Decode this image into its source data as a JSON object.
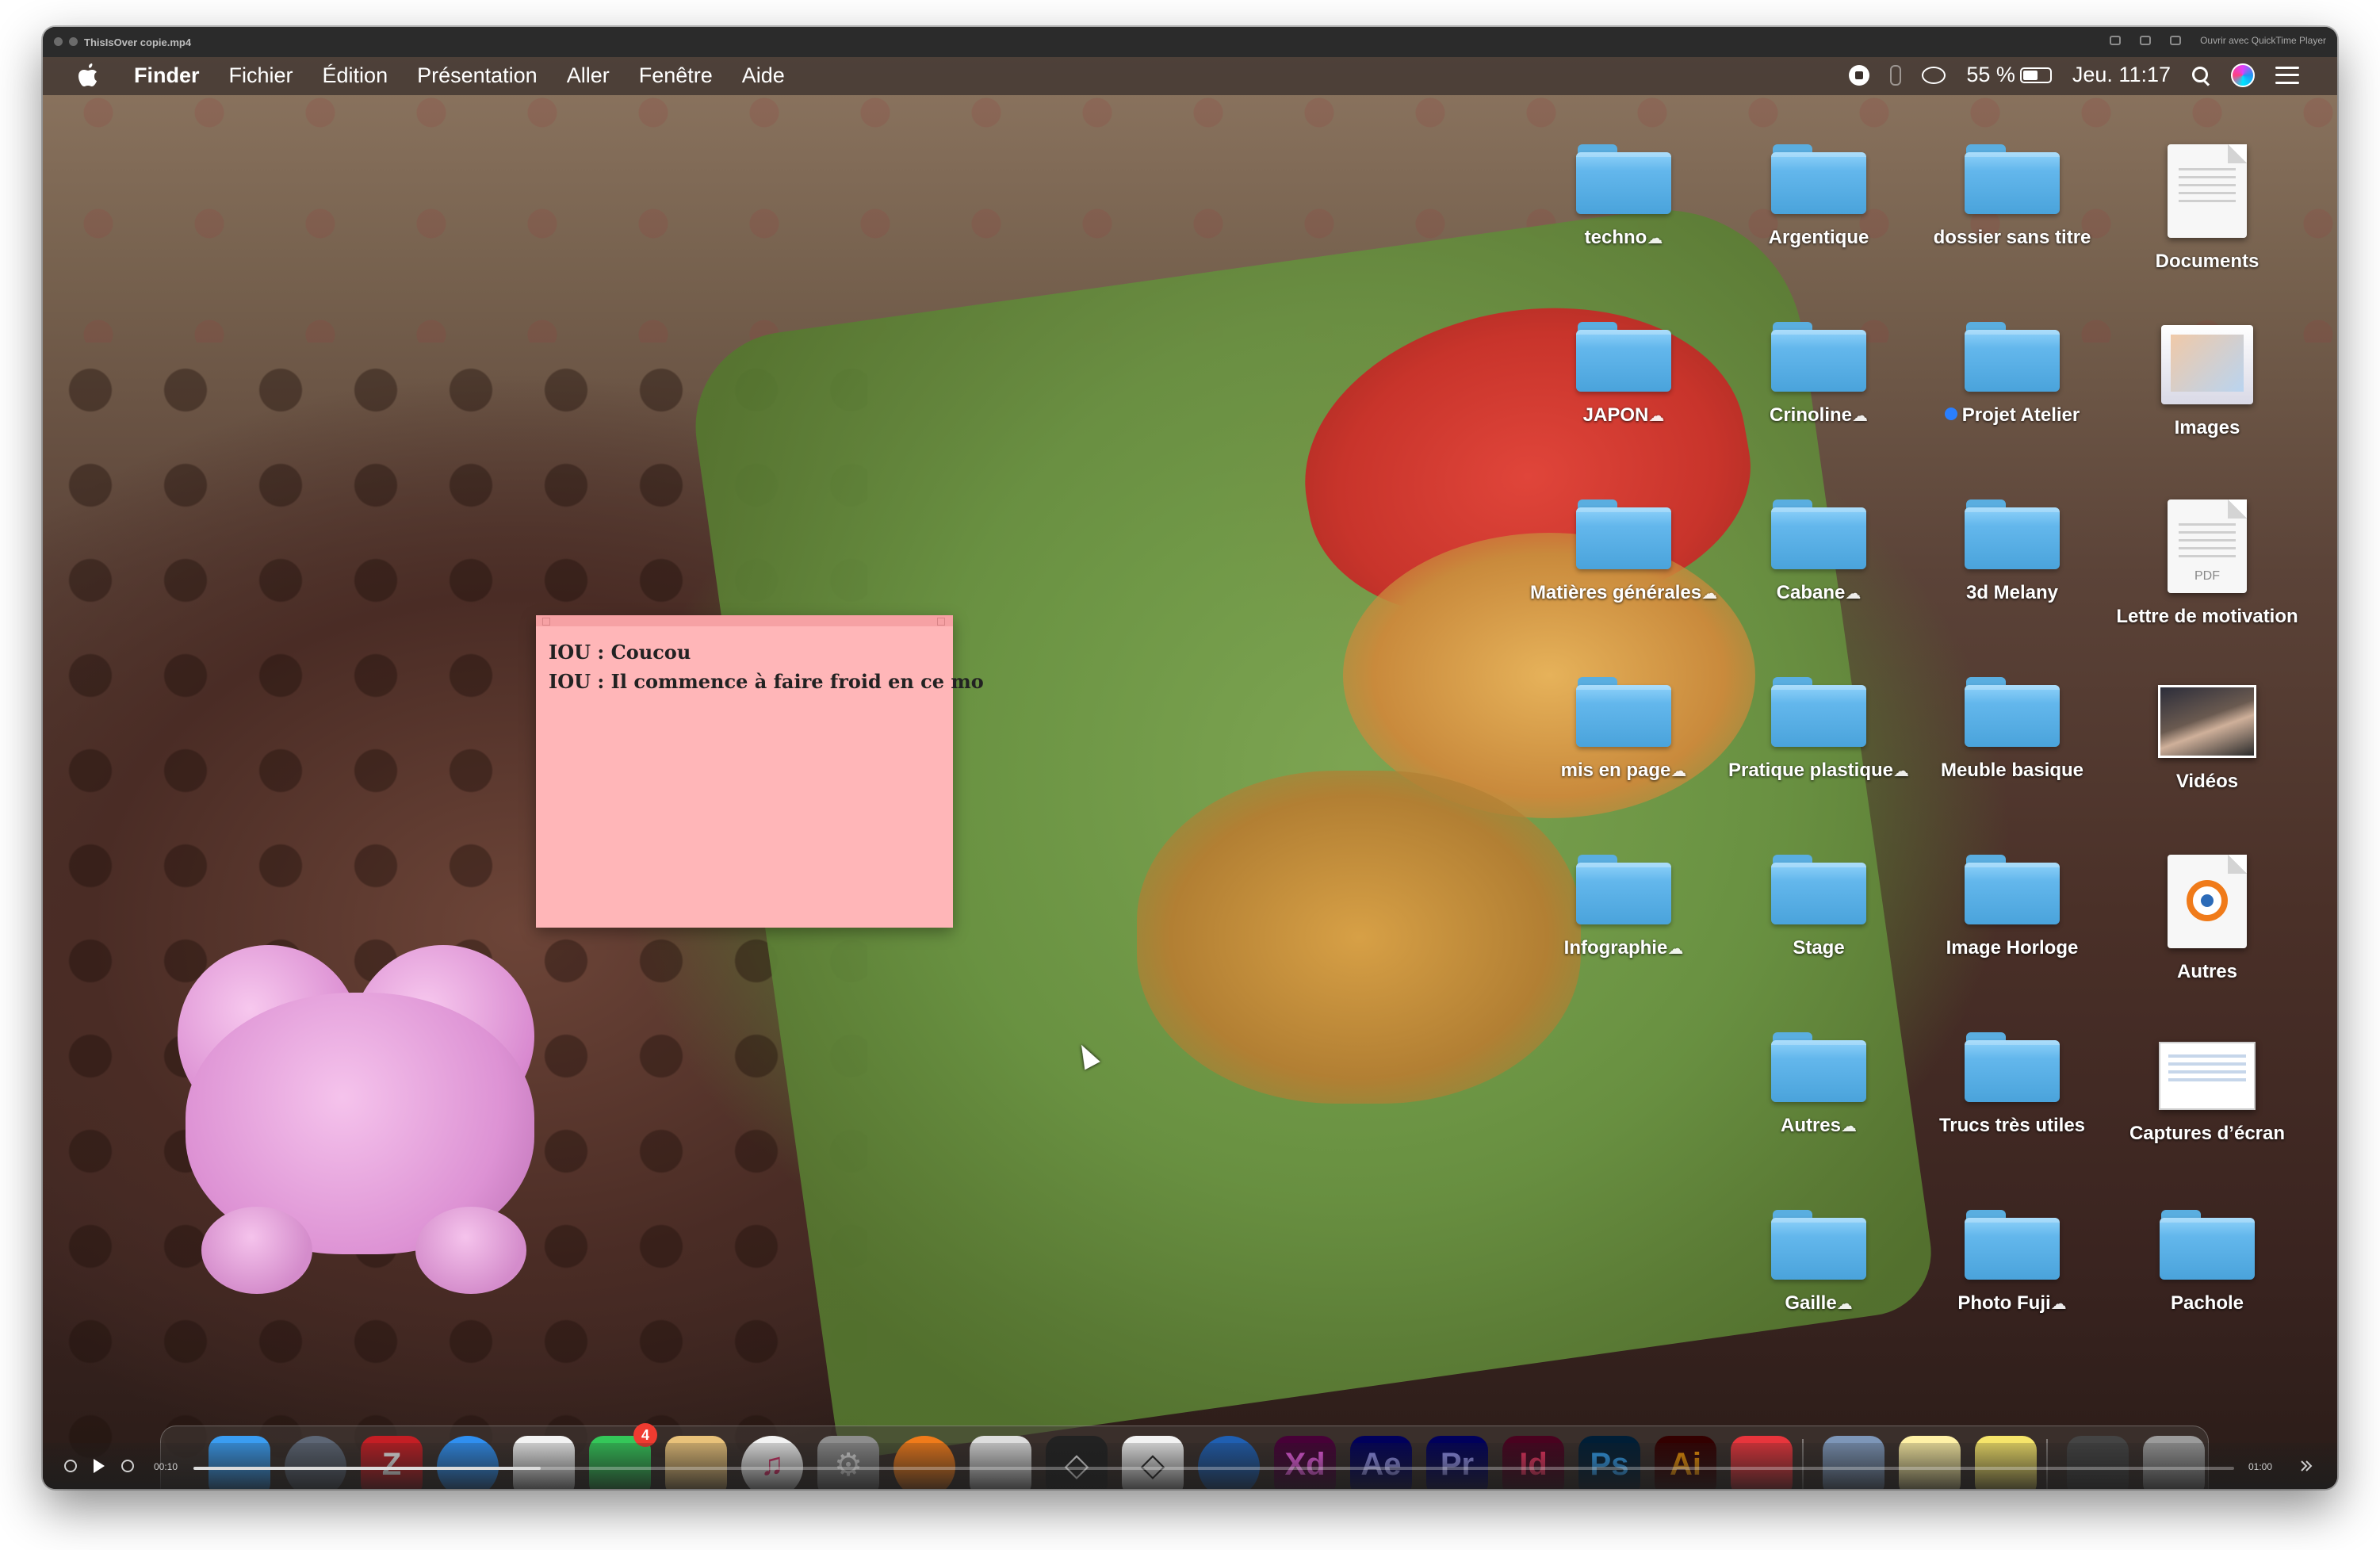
{
  "window": {
    "title": "ThisIsOver copie.mp4",
    "open_with": "Ouvrir avec QuickTime Player"
  },
  "menubar": {
    "app": "Finder",
    "menus": [
      "Fichier",
      "Édition",
      "Présentation",
      "Aller",
      "Fenêtre",
      "Aide"
    ],
    "battery": "55 %",
    "battery_level": 0.55,
    "clock": "Jeu. 11:17"
  },
  "desktop": {
    "columns": [
      [
        {
          "label": "techno",
          "kind": "folder",
          "cloud": true
        },
        {
          "label": "JAPON",
          "kind": "folder",
          "cloud": true
        },
        {
          "label": "Matières générales",
          "kind": "folder",
          "cloud": true
        },
        {
          "label": "mis en page",
          "kind": "folder",
          "cloud": true
        },
        {
          "label": "Infographie",
          "kind": "folder",
          "cloud": true
        }
      ],
      [
        {
          "label": "Argentique",
          "kind": "folder",
          "cloud": false
        },
        {
          "label": "Crinoline",
          "kind": "folder",
          "cloud": true
        },
        {
          "label": "Cabane",
          "kind": "folder",
          "cloud": true
        },
        {
          "label": "Pratique plastique",
          "kind": "folder",
          "cloud": true
        },
        {
          "label": "Stage",
          "kind": "folder",
          "cloud": false
        },
        {
          "label": "Autres",
          "kind": "folder",
          "cloud": true
        },
        {
          "label": "Gaille",
          "kind": "folder",
          "cloud": true
        }
      ],
      [
        {
          "label": "dossier sans titre",
          "kind": "folder",
          "cloud": false
        },
        {
          "label": "Projet Atelier",
          "kind": "folder",
          "cloud": false,
          "tag": "blue"
        },
        {
          "label": "3d Melany",
          "kind": "folder",
          "cloud": false
        },
        {
          "label": "Meuble basique",
          "kind": "folder",
          "cloud": false
        },
        {
          "label": "Image Horloge",
          "kind": "folder",
          "cloud": false
        },
        {
          "label": "Trucs très utiles",
          "kind": "folder",
          "cloud": false
        },
        {
          "label": "Photo Fuji",
          "kind": "folder",
          "cloud": true
        }
      ],
      [
        {
          "label": "Documents",
          "kind": "document"
        },
        {
          "label": "Images",
          "kind": "images"
        },
        {
          "label": "Lettre de motivation",
          "kind": "pdf",
          "doc_tag": "PDF"
        },
        {
          "label": "Vidéos",
          "kind": "video"
        },
        {
          "label": "Autres",
          "kind": "blender"
        },
        {
          "label": "Captures d’écran",
          "kind": "screenshot"
        },
        {
          "label": "Pachole",
          "kind": "folder",
          "cloud": false
        }
      ]
    ]
  },
  "sticky": {
    "lines": [
      "IOU : Coucou",
      "IOU : Il commence à faire froid en ce mo"
    ]
  },
  "dock": {
    "apps": [
      {
        "name": "finder-icon",
        "text": "",
        "bg": "#3a9df2",
        "fg": "#ffffff"
      },
      {
        "name": "launchpad-icon",
        "text": "",
        "bg": "#5d6675",
        "fg": "#ffffff"
      },
      {
        "name": "filezilla-icon",
        "text": "Z",
        "bg": "#c41e24",
        "fg": "#ffffff"
      },
      {
        "name": "safari-icon",
        "text": "",
        "bg": "#2f8ff0",
        "fg": "#ffffff"
      },
      {
        "name": "photos-icon",
        "text": "",
        "bg": "#f3f3f3",
        "fg": "#ffffff"
      },
      {
        "name": "facetime-icon",
        "text": "",
        "bg": "#34c759",
        "fg": "#ffffff",
        "badge": "4"
      },
      {
        "name": "preview-icon",
        "text": "",
        "bg": "#e9c27a",
        "fg": "#ffffff"
      },
      {
        "name": "itunes-icon",
        "text": "♫",
        "bg": "#f2f2f2",
        "fg": "#e2306c"
      },
      {
        "name": "system-preferences-icon",
        "text": "⚙",
        "bg": "#8d8d8d",
        "fg": "#e8e8e8"
      },
      {
        "name": "blender-icon",
        "text": "",
        "bg": "#f07b1a",
        "fg": "#ffffff"
      },
      {
        "name": "inkscape-icon",
        "text": "",
        "bg": "#dddddd",
        "fg": "#333333"
      },
      {
        "name": "unity-dark-icon",
        "text": "◇",
        "bg": "#222222",
        "fg": "#ffffff"
      },
      {
        "name": "unity-hub-icon",
        "text": "◇",
        "bg": "#f2f2f2",
        "fg": "#222222"
      },
      {
        "name": "aperture-icon",
        "text": "",
        "bg": "#1f5fb2",
        "fg": "#ffffff"
      },
      {
        "name": "adobe-xd-icon",
        "text": "Xd",
        "bg": "#470137",
        "fg": "#ff61f6"
      },
      {
        "name": "after-effects-icon",
        "text": "Ae",
        "bg": "#00005b",
        "fg": "#9999ff"
      },
      {
        "name": "premiere-icon",
        "text": "Pr",
        "bg": "#00005b",
        "fg": "#9999ff"
      },
      {
        "name": "indesign-icon",
        "text": "Id",
        "bg": "#49021f",
        "fg": "#ff3366"
      },
      {
        "name": "photoshop-icon",
        "text": "Ps",
        "bg": "#001e36",
        "fg": "#31a8ff"
      },
      {
        "name": "illustrator-icon",
        "text": "Ai",
        "bg": "#330000",
        "fg": "#ff9a00"
      },
      {
        "name": "screen-recorder-icon",
        "text": "",
        "bg": "#e8353c",
        "fg": "#ffffff"
      },
      {
        "name": "image-capture-icon",
        "text": "",
        "bg": "#7d96b8",
        "fg": "#ffffff"
      },
      {
        "name": "notes-icon",
        "text": "",
        "bg": "#fff1a6",
        "fg": "#333333"
      },
      {
        "name": "stickies-icon",
        "text": "",
        "bg": "#f6e56a",
        "fg": "#333333"
      },
      {
        "name": "downloads-stack-icon",
        "text": "",
        "bg": "#444444",
        "fg": "#ffffff"
      },
      {
        "name": "trash-icon",
        "text": "",
        "bg": "#9b9b9b",
        "fg": "#ffffff"
      }
    ]
  },
  "player": {
    "current_time": "00:10",
    "duration": "01:00",
    "progress": 0.17
  }
}
